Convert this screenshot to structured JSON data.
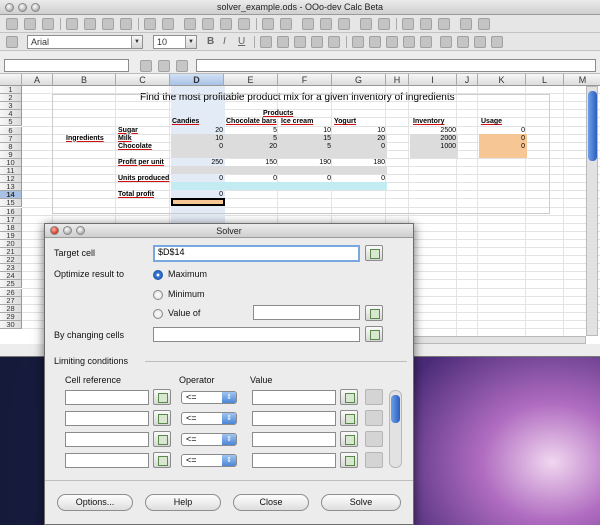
{
  "window": {
    "title": "solver_example.ods - OOo-dev Calc Beta"
  },
  "toolbar": {
    "font_name": "Arial",
    "font_size": "10",
    "bold": "B",
    "italic": "I",
    "underline": "U"
  },
  "sheet": {
    "columns": [
      "A",
      "B",
      "C",
      "D",
      "E",
      "F",
      "G",
      "H",
      "I",
      "J",
      "K",
      "L",
      "M"
    ],
    "rows": [
      "1",
      "2",
      "3",
      "4",
      "5",
      "6",
      "7",
      "8",
      "9",
      "10",
      "11",
      "12",
      "13",
      "14",
      "15",
      "16",
      "17",
      "18",
      "19",
      "20",
      "21",
      "22",
      "23",
      "24",
      "25",
      "26",
      "27",
      "28",
      "29",
      "30"
    ],
    "selected_column": "D",
    "selected_row": "14",
    "title": "Find the most profitable product mix for a given inventory of ingredients",
    "products_header": "Products",
    "product_names": [
      "Candies",
      "Chocolate bars",
      "Ice cream",
      "Yogurt"
    ],
    "inventory_header": "Inventory",
    "usage_header": "Usage",
    "ingredients_label": "Ingredients",
    "ingredients": [
      {
        "name": "Sugar",
        "values": [
          "20",
          "5",
          "10",
          "10"
        ],
        "inventory": "2500",
        "usage": "0"
      },
      {
        "name": "Milk",
        "values": [
          "10",
          "5",
          "15",
          "20"
        ],
        "inventory": "2000",
        "usage": "0"
      },
      {
        "name": "Chocolate",
        "values": [
          "0",
          "20",
          "5",
          "0"
        ],
        "inventory": "1000",
        "usage": "0"
      }
    ],
    "profit_label": "Profit per unit",
    "profit_values": [
      "250",
      "150",
      "190",
      "180"
    ],
    "units_label": "Units produced",
    "units_values": [
      "0",
      "0",
      "0",
      "0"
    ],
    "total_label": "Total profit",
    "total_value": "0"
  },
  "solver": {
    "title": "Solver",
    "target_cell_label": "Target cell",
    "target_cell_value": "$D$14",
    "optimize_label": "Optimize result to",
    "option_maximum": "Maximum",
    "option_minimum": "Minimum",
    "option_value_of": "Value of",
    "selected_option": "Maximum",
    "value_of_text": "",
    "changing_cells_label": "By changing cells",
    "changing_cells_value": "",
    "limiting_label": "Limiting conditions",
    "col_cell_reference": "Cell reference",
    "col_operator": "Operator",
    "col_value": "Value",
    "conditions": [
      {
        "cell": "",
        "operator": "<=",
        "value": ""
      },
      {
        "cell": "",
        "operator": "<=",
        "value": ""
      },
      {
        "cell": "",
        "operator": "<=",
        "value": ""
      },
      {
        "cell": "",
        "operator": "<=",
        "value": ""
      }
    ],
    "buttons": {
      "options": "Options...",
      "help": "Help",
      "close": "Close",
      "solve": "Solve"
    }
  },
  "colors": {
    "usage_fill": "#f6c695",
    "units_fill": "#c3ecf2",
    "input_fill": "#dcdcdc",
    "selection": "#a8c2e6"
  }
}
